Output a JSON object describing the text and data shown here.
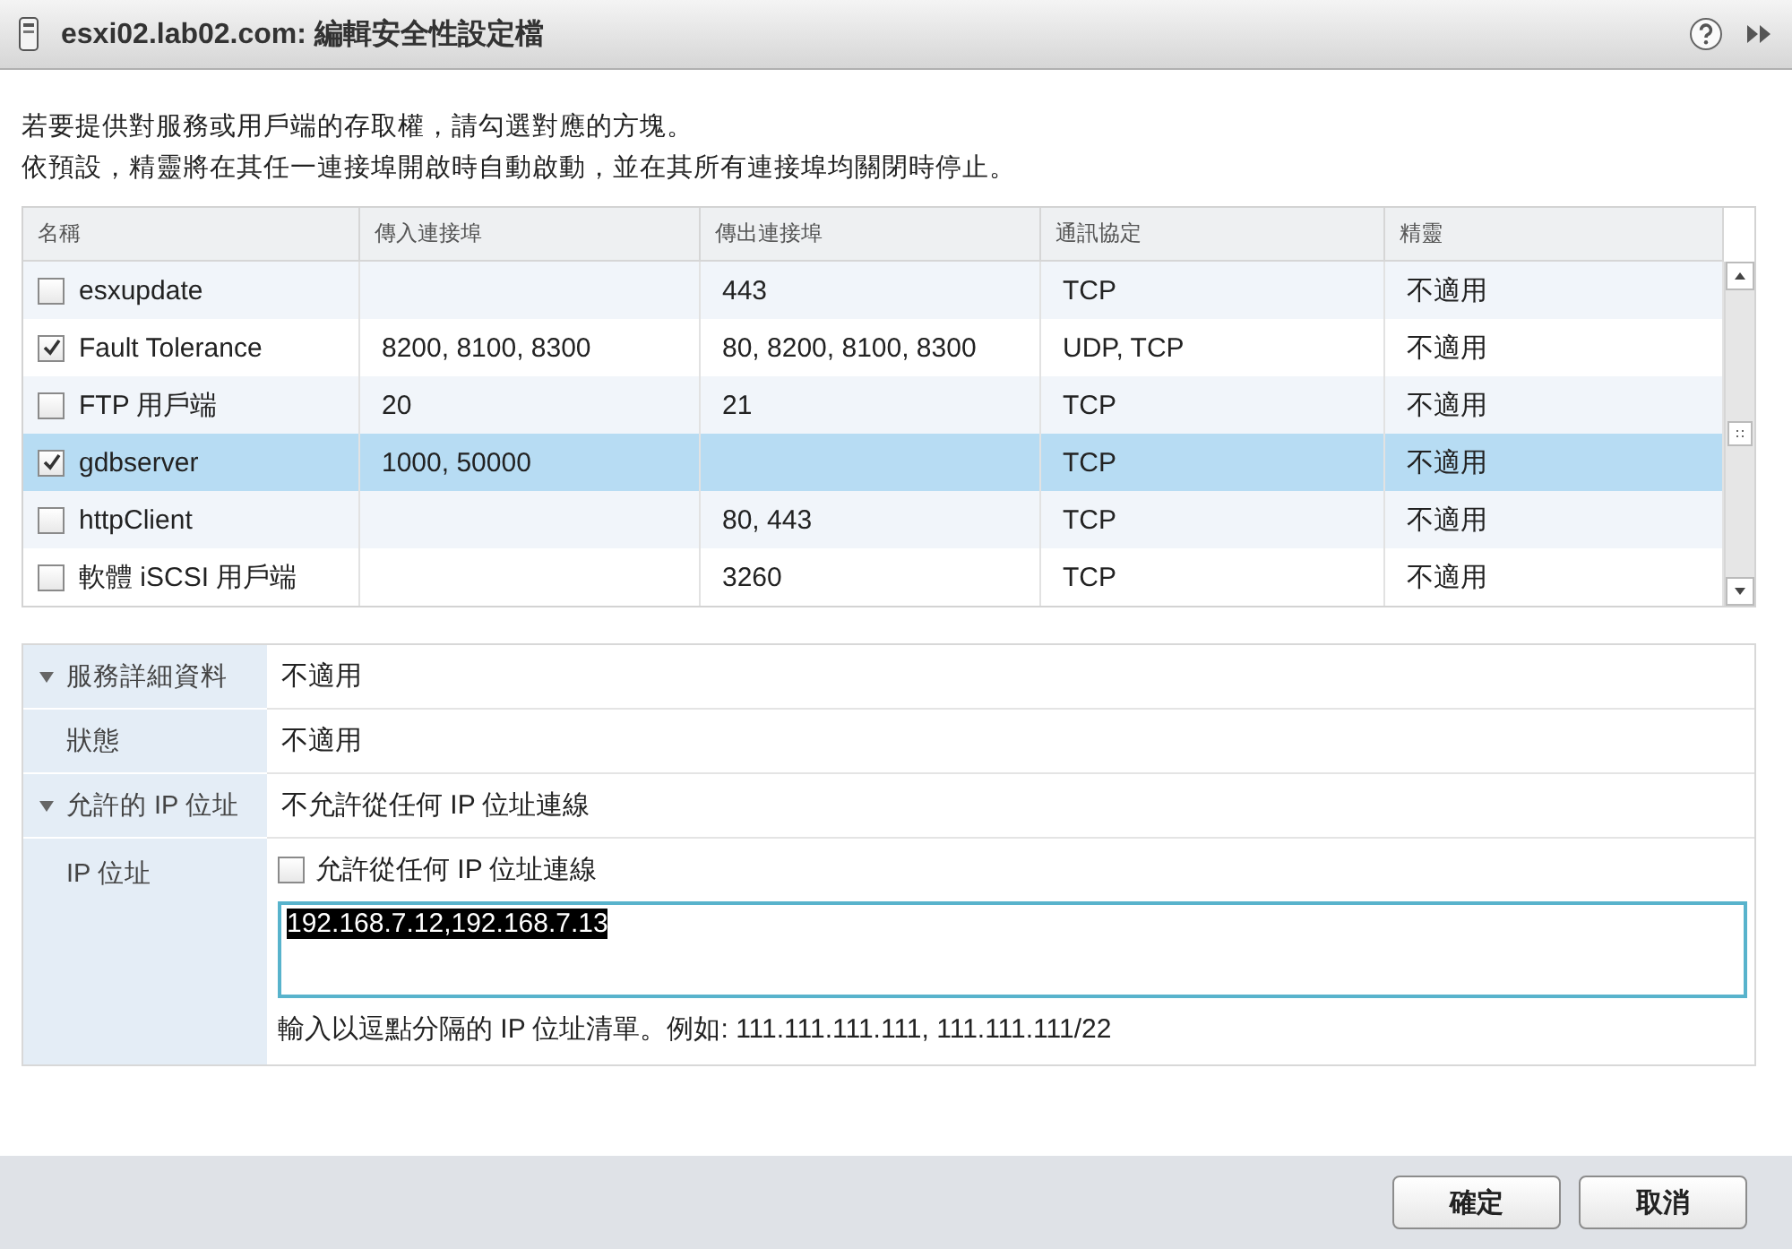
{
  "window": {
    "title": "esxi02.lab02.com: 編輯安全性設定檔"
  },
  "intro": [
    "若要提供對服務或用戶端的存取權，請勾選對應的方塊。",
    "依預設，精靈將在其任一連接埠開啟時自動啟動，並在其所有連接埠均關閉時停止。"
  ],
  "table": {
    "columns": [
      "名稱",
      "傳入連接埠",
      "傳出連接埠",
      "通訊協定",
      "精靈"
    ],
    "rows": [
      {
        "name": "esxupdate",
        "checked": false,
        "selected": false,
        "incoming": "",
        "outgoing": "443",
        "protocol": "TCP",
        "daemon": "不適用"
      },
      {
        "name": "Fault Tolerance",
        "checked": true,
        "selected": false,
        "incoming": "8200, 8100, 8300",
        "outgoing": "80, 8200, 8100, 8300",
        "protocol": "UDP, TCP",
        "daemon": "不適用"
      },
      {
        "name": "FTP 用戶端",
        "checked": false,
        "selected": false,
        "incoming": "20",
        "outgoing": "21",
        "protocol": "TCP",
        "daemon": "不適用"
      },
      {
        "name": "gdbserver",
        "checked": true,
        "selected": true,
        "incoming": "1000, 50000",
        "outgoing": "",
        "protocol": "TCP",
        "daemon": "不適用"
      },
      {
        "name": "httpClient",
        "checked": false,
        "selected": false,
        "incoming": "",
        "outgoing": "80, 443",
        "protocol": "TCP",
        "daemon": "不適用"
      },
      {
        "name": "軟體 iSCSI 用戶端",
        "checked": false,
        "selected": false,
        "incoming": "",
        "outgoing": "3260",
        "protocol": "TCP",
        "daemon": "不適用"
      }
    ]
  },
  "details": {
    "sections": [
      {
        "label": "服務詳細資料",
        "value": "不適用",
        "expanded": true,
        "rows": [
          {
            "label": "狀態",
            "value": "不適用"
          }
        ]
      },
      {
        "label": "允許的 IP 位址",
        "value": "不允許從任何 IP 位址連線",
        "expanded": true
      }
    ],
    "ip": {
      "label": "IP 位址",
      "allow_any": {
        "label": "允許從任何 IP 位址連線",
        "checked": false
      },
      "value": "192.168.7.12,192.168.7.13",
      "hint": "輸入以逗點分隔的 IP 位址清單。例如: 111.111.111.111, 111.111.111/22"
    }
  },
  "buttons": [
    "確定",
    "取消"
  ]
}
